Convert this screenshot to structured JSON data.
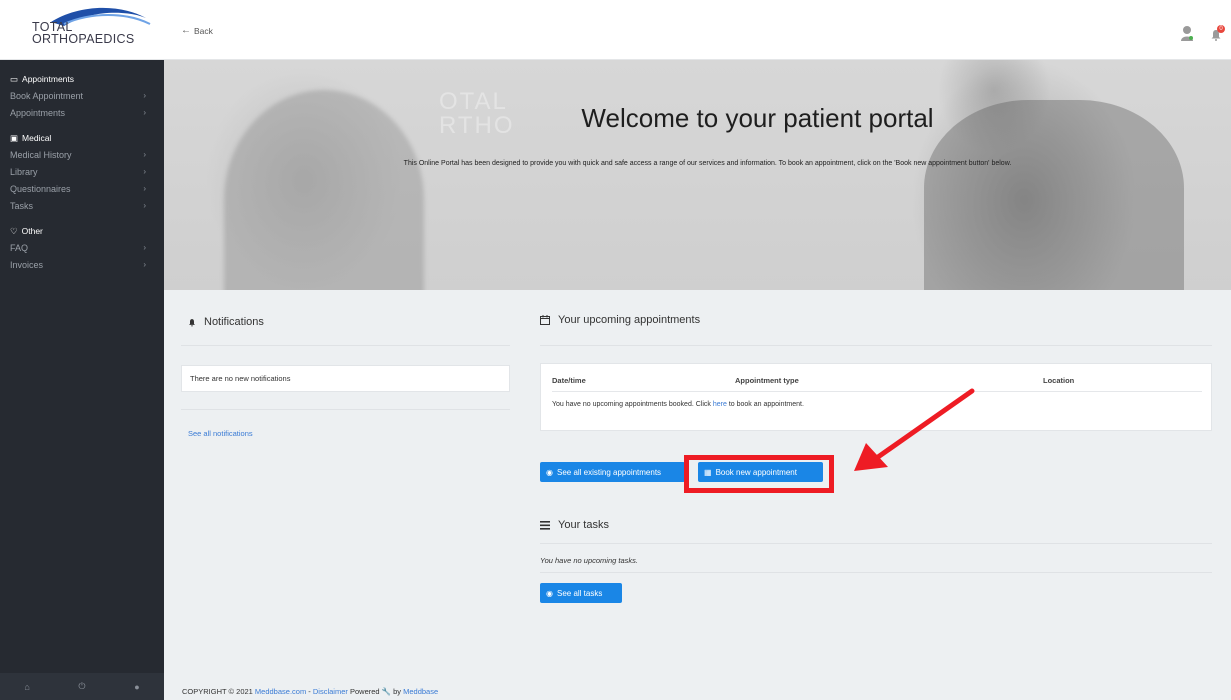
{
  "header": {
    "logo_line1": "TOTAL",
    "logo_line2": "ORTHOPAEDICS",
    "back_label": "Back",
    "notification_count": "0"
  },
  "sidebar": {
    "groups": [
      {
        "heading": "Appointments",
        "icon": "calendar-icon",
        "items": [
          "Book Appointment",
          "Appointments"
        ]
      },
      {
        "heading": "Medical",
        "icon": "briefcase-medical-icon",
        "items": [
          "Medical History",
          "Library",
          "Questionnaires",
          "Tasks"
        ]
      },
      {
        "heading": "Other",
        "icon": "heart-icon",
        "items": [
          "FAQ",
          "Invoices"
        ]
      }
    ],
    "footer_icons": [
      "home-icon",
      "power-icon",
      "user-icon"
    ]
  },
  "hero": {
    "faded_logo_line1": "OTAL",
    "faded_logo_line2": "RTHO",
    "title": "Welcome to your patient portal",
    "subtitle": "This Online Portal has been designed to provide you with quick and safe access a range of our services and information. To book an appointment, click on the 'Book new appointment button' below."
  },
  "notifications": {
    "title": "Notifications",
    "empty_message": "There are no new notifications",
    "see_all_label": "See all notifications"
  },
  "appointments": {
    "title": "Your upcoming appointments",
    "columns": [
      "Date/time",
      "Appointment type",
      "Location"
    ],
    "empty_before": "You have no upcoming appointments booked. Click ",
    "empty_link": "here",
    "empty_after": " to book an appointment.",
    "see_existing_label": "See all existing appointments",
    "book_new_label": "Book new appointment"
  },
  "tasks": {
    "title": "Your tasks",
    "empty_message": "You have no upcoming tasks.",
    "see_all_label": "See all tasks"
  },
  "footer": {
    "copyright": "COPYRIGHT © 2021 ",
    "company_link": "Meddbase.com",
    "separator": " - ",
    "disclaimer_link": "Disclaimer",
    "powered": " Powered ",
    "by": " by ",
    "brand_link": "Meddbase"
  },
  "colors": {
    "primary": "#1a86e6",
    "sidebar_bg": "#262a31",
    "highlight": "#ee1c24",
    "link": "#3a7bd5"
  }
}
